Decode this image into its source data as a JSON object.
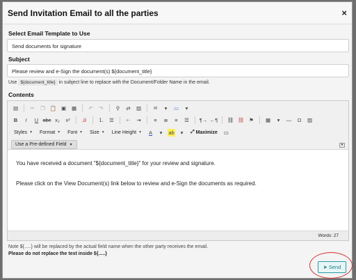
{
  "dialog": {
    "title": "Send Invitation Email to all the parties",
    "close_label": "×"
  },
  "template": {
    "label": "Select Email Template to Use",
    "value": "Send documents for signature"
  },
  "subject": {
    "label": "Subject",
    "value": "Please review and e-Sign the document(s) ${document_title}",
    "hint_prefix": "Use",
    "hint_code": "${document_title}",
    "hint_suffix": "in subject line to replace with the Document/Folder Name in the email."
  },
  "contents": {
    "label": "Contents",
    "toolbar": {
      "styles": "Styles",
      "format": "Format",
      "font": "Font",
      "size": "Size",
      "line_height": "Line Height",
      "maximize": "Maximize",
      "predefined_field": "Use a Pre-defined Field"
    },
    "paragraphs": [
      "You have received a document \"${document_title}\" for your review and signature.",
      "Please click on the View Document(s) link below to review and e-Sign the documents as required."
    ],
    "word_count": "Words: 27"
  },
  "notes": {
    "line1": "Note ${.....} will be replaced by the actual field name when the other party receives the email.",
    "line2": "Please do not replace the text inside ${.....}"
  },
  "send_button": {
    "label": "Send",
    "icon": "paper-plane-icon"
  },
  "highlight_color": "#d32f2f"
}
